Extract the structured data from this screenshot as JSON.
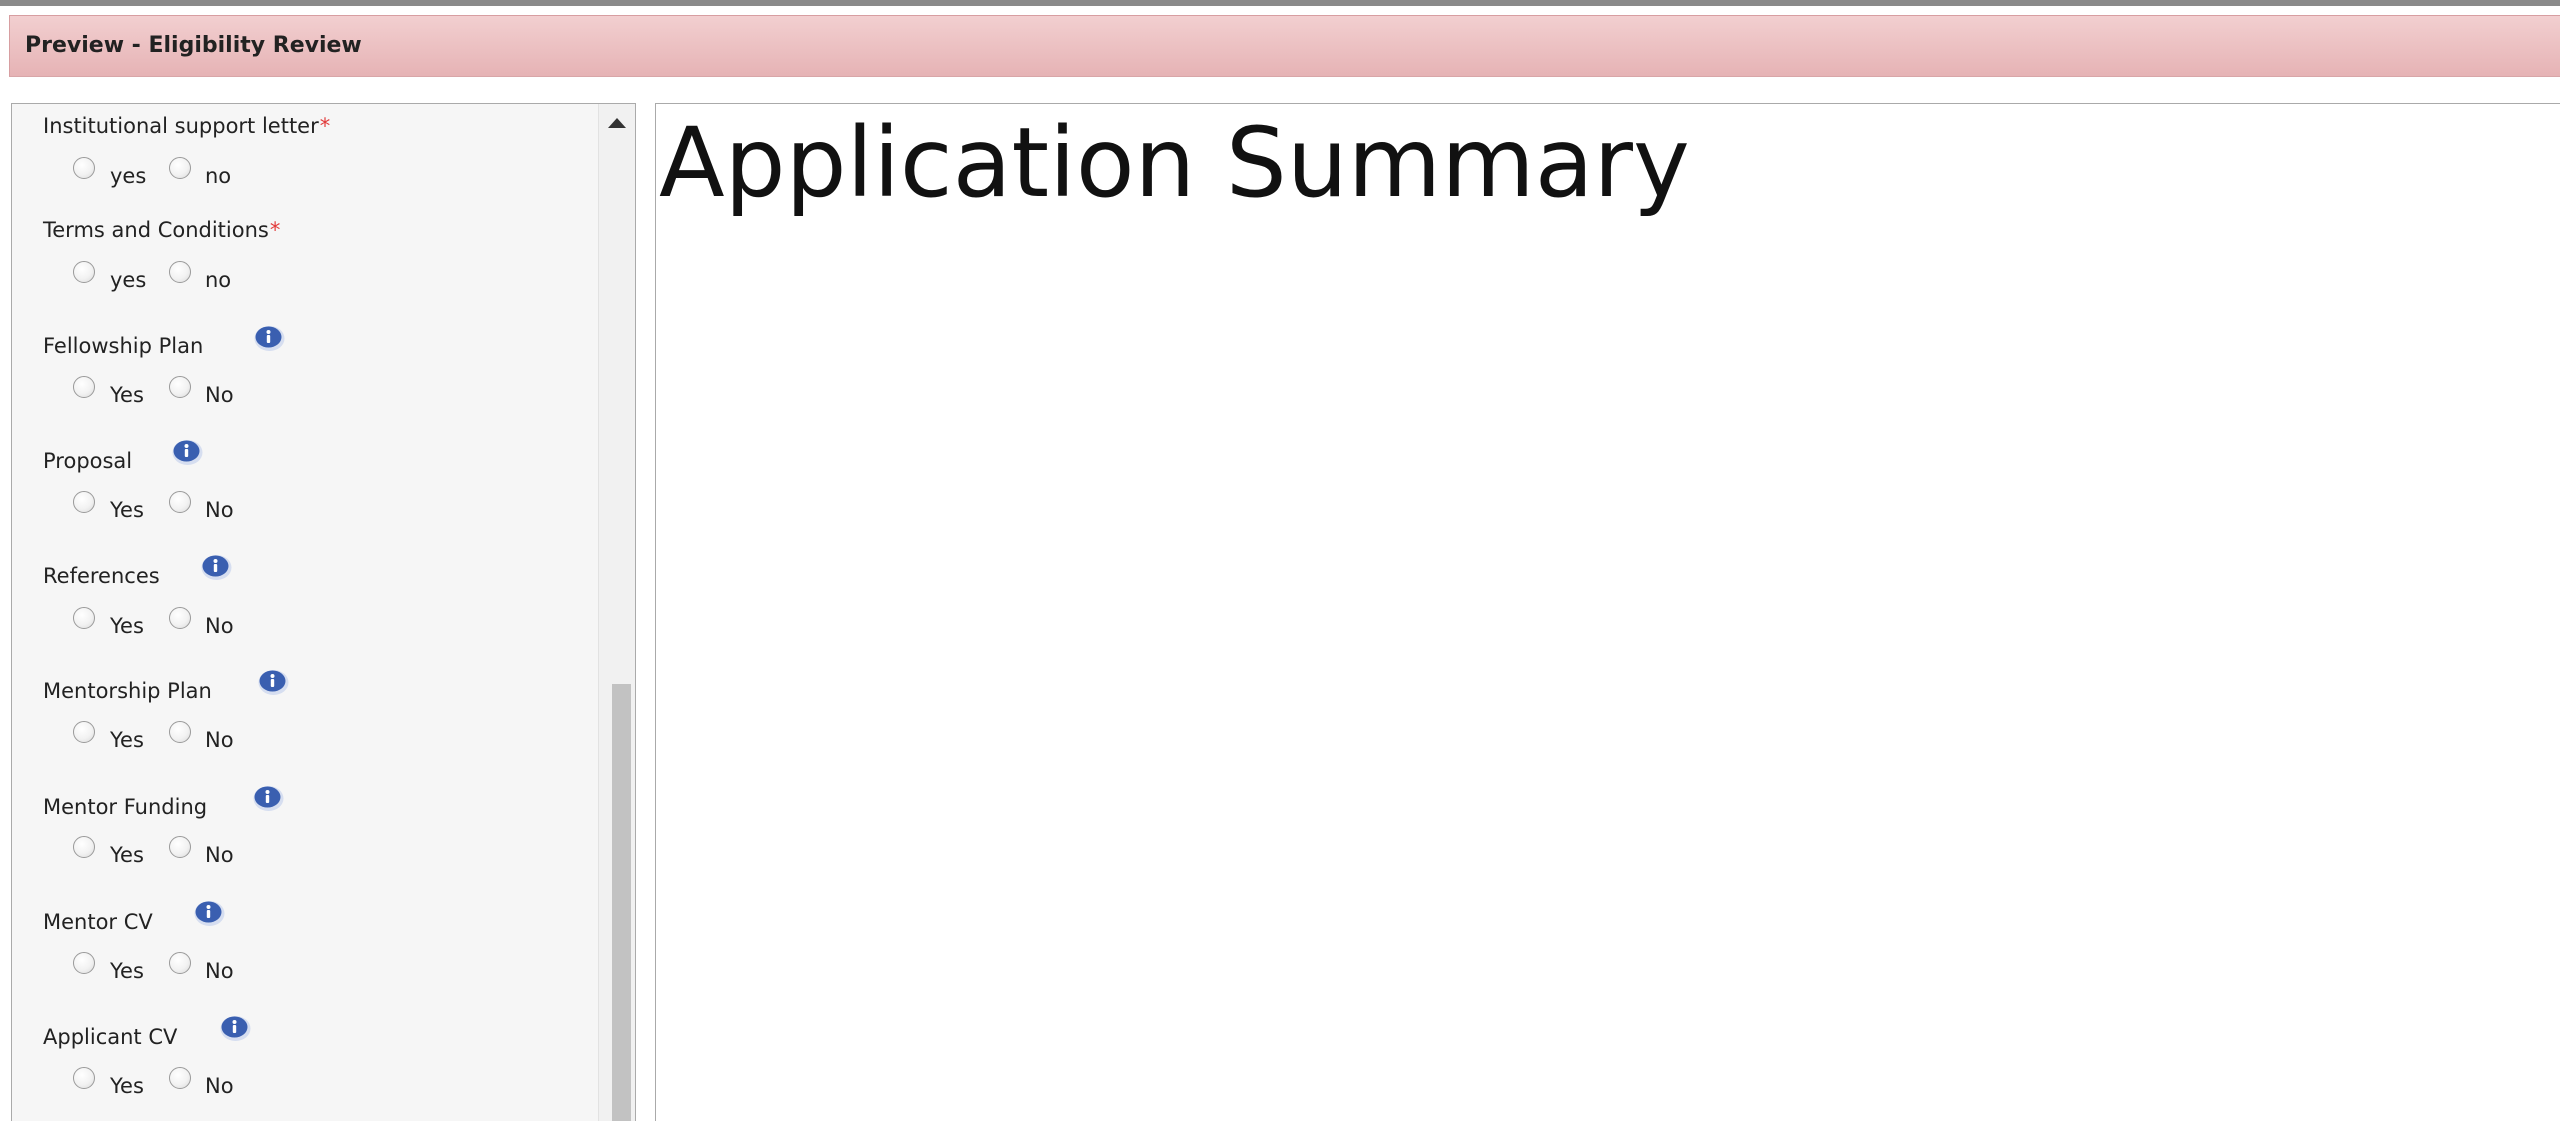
{
  "window": {
    "title": "Preview - Eligibility Review"
  },
  "eligibility": {
    "questions": [
      {
        "label": "Institutional support letter",
        "required_mark": "*",
        "options": [
          "yes",
          "no"
        ]
      },
      {
        "label": "Terms and Conditions",
        "required_mark": "*",
        "options": [
          "yes",
          "no"
        ]
      },
      {
        "label": "Fellowship Plan",
        "info_icon": "info-icon",
        "options": [
          "Yes",
          "No"
        ]
      },
      {
        "label": "Proposal",
        "info_icon": "info-icon",
        "options": [
          "Yes",
          "No"
        ]
      },
      {
        "label": "References",
        "info_icon": "info-icon",
        "options": [
          "Yes",
          "No"
        ]
      },
      {
        "label": "Mentorship Plan",
        "info_icon": "info-icon",
        "options": [
          "Yes",
          "No"
        ]
      },
      {
        "label": "Mentor Funding",
        "info_icon": "info-icon",
        "options": [
          "Yes",
          "No"
        ]
      },
      {
        "label": "Mentor CV",
        "info_icon": "info-icon",
        "options": [
          "Yes",
          "No"
        ]
      },
      {
        "label": "Applicant CV",
        "info_icon": "info-icon",
        "options": [
          "Yes",
          "No"
        ]
      }
    ]
  },
  "summary": {
    "title": "Application Summary"
  },
  "colors": {
    "title_bar": "#e6b3b5",
    "required": "#e23b3b",
    "info_icon": "#3a5fb0",
    "panel_background": "#f6f6f6"
  }
}
